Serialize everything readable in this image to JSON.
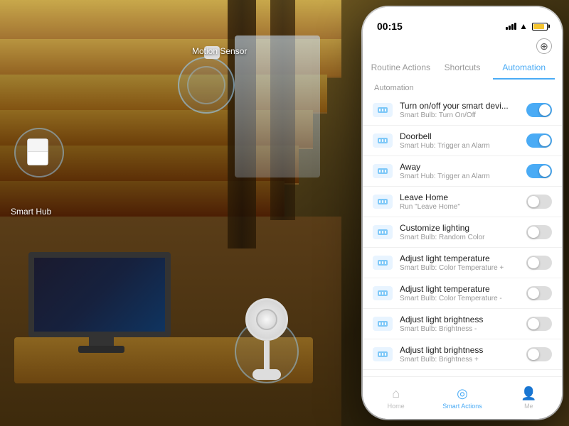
{
  "background": {
    "motion_sensor_label": "Motion Sensor",
    "smart_hub_label": "Smart Hub"
  },
  "phone": {
    "status_bar": {
      "time": "00:15",
      "add_button": "+"
    },
    "tabs": [
      {
        "label": "Routine Actions",
        "active": false
      },
      {
        "label": "Shortcuts",
        "active": false
      },
      {
        "label": "Automation",
        "active": true
      }
    ],
    "section_label": "Automation",
    "add_icon": "⊕",
    "automation_items": [
      {
        "title": "Turn on/off your smart devi...",
        "subtitle": "Smart Bulb: Turn On/Off",
        "toggle": "on"
      },
      {
        "title": "Doorbell",
        "subtitle": "Smart Hub: Trigger an Alarm",
        "toggle": "on"
      },
      {
        "title": "Away",
        "subtitle": "Smart Hub: Trigger an Alarm",
        "toggle": "on"
      },
      {
        "title": "Leave Home",
        "subtitle": "Run \"Leave Home\"",
        "toggle": "off"
      },
      {
        "title": "Customize lighting",
        "subtitle": "Smart Bulb: Random Color",
        "toggle": "off"
      },
      {
        "title": "Adjust light temperature",
        "subtitle": "Smart Bulb: Color Temperature +",
        "toggle": "off"
      },
      {
        "title": "Adjust light temperature",
        "subtitle": "Smart Bulb: Color Temperature -",
        "toggle": "off"
      },
      {
        "title": "Adjust light brightness",
        "subtitle": "Smart Bulb: Brightness -",
        "toggle": "off"
      },
      {
        "title": "Adjust light brightness",
        "subtitle": "Smart Bulb: Brightness +",
        "toggle": "off"
      }
    ],
    "bottom_nav": [
      {
        "label": "Home",
        "icon": "⌂",
        "active": false
      },
      {
        "label": "Smart Actions",
        "icon": "◎",
        "active": true
      },
      {
        "label": "Me",
        "icon": "👤",
        "active": false
      }
    ]
  }
}
